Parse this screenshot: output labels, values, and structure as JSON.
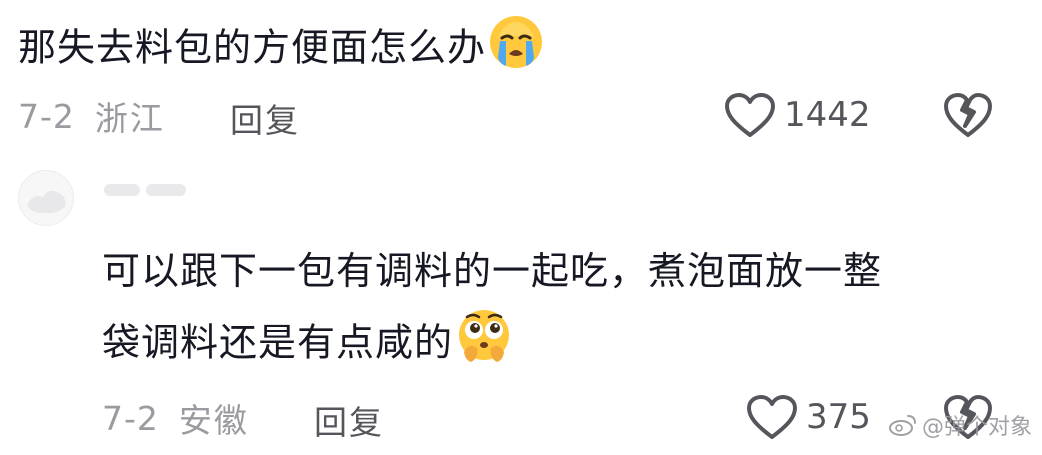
{
  "comments": [
    {
      "text": "那失去料包的方便面怎么办",
      "emoji": "crying-face",
      "date": "7-2",
      "location": "浙江",
      "reply_label": "回复",
      "likes": "1442"
    },
    {
      "text_line1": "可以跟下一包有调料的一起吃，煮泡面放一整",
      "text_line2": "袋调料还是有点咸的",
      "emoji": "pleading-face",
      "date": "7-2",
      "location": "安徽",
      "reply_label": "回复",
      "likes": "375"
    }
  ],
  "watermark": "@弹个对象",
  "colors": {
    "text": "#161823",
    "meta": "#9a9aa0",
    "action": "#55565c"
  }
}
